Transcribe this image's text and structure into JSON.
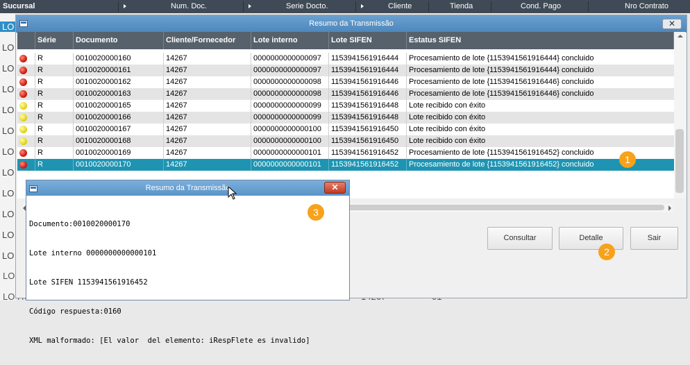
{
  "background": {
    "header_columns": [
      "Sucursal",
      "Num. Doc.",
      "Serie Docto.",
      "Cliente",
      "Tienda",
      "Cond. Pago",
      "Nro Contrato"
    ],
    "left_prefix": "LO",
    "bottom_rows": [
      {
        "prefix": "LO HC",
        "cliente": "14267",
        "tienda": "01"
      },
      {
        "prefix": "LO HC",
        "cliente": "14267",
        "tienda": "01"
      }
    ]
  },
  "main_dialog": {
    "title": "Resumo da Transmissão",
    "close_symbol": "✕",
    "columns": [
      "",
      "Série",
      "Documento",
      "Cliente/Fornecedor",
      "Lote interno",
      "Lote SIFEN",
      "Estatus SIFEN"
    ],
    "rows": [
      {
        "status": "red",
        "serie": "R",
        "documento": "0010020000160",
        "cliente": "14267",
        "lote_interno": "0000000000000097",
        "lote_sifen": "1153941561916444",
        "estatus": "Procesamiento de lote {1153941561916444} concluido"
      },
      {
        "status": "red",
        "serie": "R",
        "documento": "0010020000161",
        "cliente": "14267",
        "lote_interno": "0000000000000097",
        "lote_sifen": "1153941561916444",
        "estatus": "Procesamiento de lote {1153941561916444} concluido"
      },
      {
        "status": "red",
        "serie": "R",
        "documento": "0010020000162",
        "cliente": "14267",
        "lote_interno": "0000000000000098",
        "lote_sifen": "1153941561916446",
        "estatus": "Procesamiento de lote {1153941561916446} concluido"
      },
      {
        "status": "red",
        "serie": "R",
        "documento": "0010020000163",
        "cliente": "14267",
        "lote_interno": "0000000000000098",
        "lote_sifen": "1153941561916446",
        "estatus": "Procesamiento de lote {1153941561916446} concluido"
      },
      {
        "status": "yellow",
        "serie": "R",
        "documento": "0010020000165",
        "cliente": "14267",
        "lote_interno": "0000000000000099",
        "lote_sifen": "1153941561916448",
        "estatus": "Lote recibido con éxito"
      },
      {
        "status": "yellow",
        "serie": "R",
        "documento": "0010020000166",
        "cliente": "14267",
        "lote_interno": "0000000000000099",
        "lote_sifen": "1153941561916448",
        "estatus": "Lote recibido con éxito"
      },
      {
        "status": "yellow",
        "serie": "R",
        "documento": "0010020000167",
        "cliente": "14267",
        "lote_interno": "0000000000000100",
        "lote_sifen": "1153941561916450",
        "estatus": "Lote recibido con éxito"
      },
      {
        "status": "yellow",
        "serie": "R",
        "documento": "0010020000168",
        "cliente": "14267",
        "lote_interno": "0000000000000100",
        "lote_sifen": "1153941561916450",
        "estatus": "Lote recibido con éxito"
      },
      {
        "status": "red",
        "serie": "R",
        "documento": "0010020000169",
        "cliente": "14267",
        "lote_interno": "0000000000000101",
        "lote_sifen": "1153941561916452",
        "estatus": "Procesamiento de lote {1153941561916452} concluido"
      },
      {
        "status": "red",
        "serie": "R",
        "documento": "0010020000170",
        "cliente": "14267",
        "lote_interno": "0000000000000101",
        "lote_sifen": "1153941561916452",
        "estatus": "Procesamiento de lote {1153941561916452} concluido",
        "selected": true
      }
    ],
    "buttons": {
      "consultar": "Consultar",
      "detalle": "Detalle",
      "sair": "Sair"
    },
    "badges": [
      "1",
      "2",
      "3"
    ]
  },
  "popup": {
    "title": "Resumo da Transmissão",
    "close_symbol": "✕",
    "lines": [
      "Documento:0010020000170",
      "Lote interno 0000000000000101",
      "Lote SIFEN 1153941561916452",
      "Código respuesta:0160",
      "XML malformado: [El valor  del elemento: iRespFlete es invalido]"
    ]
  },
  "colors": {
    "selected_row": "#1e94b2",
    "status_red": "#d11e12",
    "status_yellow": "#e6d81a",
    "badge": "#f7a21b"
  }
}
